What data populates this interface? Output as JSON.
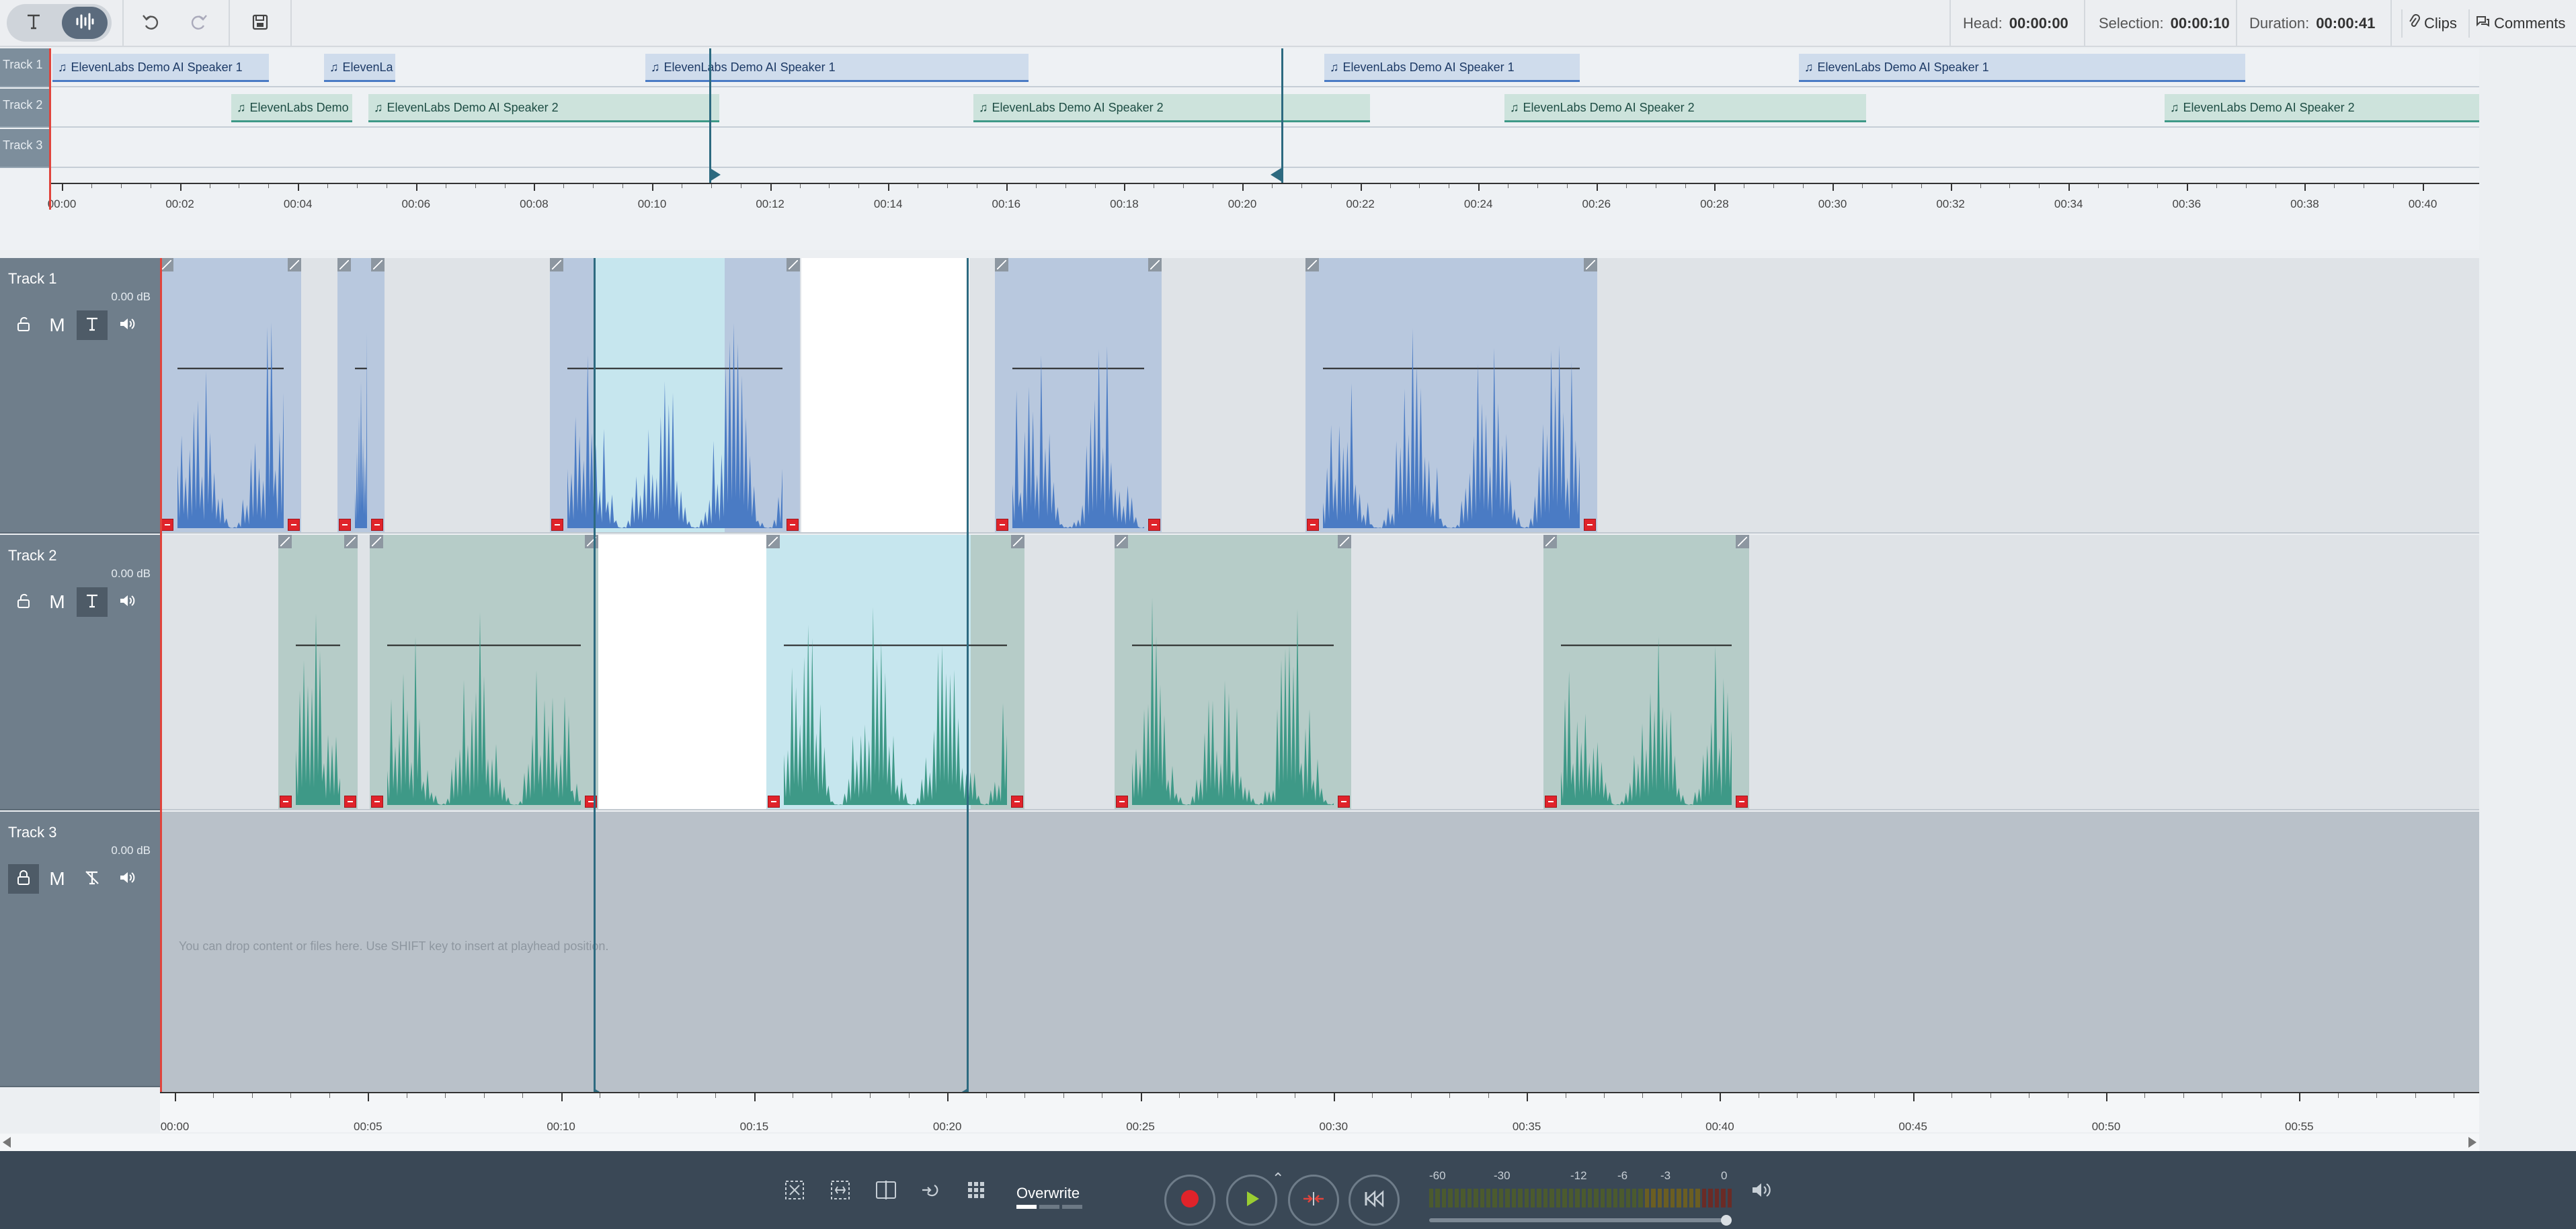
{
  "toolbar": {
    "mode_text_icon": "text-mode-icon",
    "mode_wave_icon": "waveform-mode-icon",
    "head_label": "Head:",
    "head_value": "00:00:00",
    "selection_label": "Selection:",
    "selection_value": "00:00:10",
    "duration_label": "Duration:",
    "duration_value": "00:00:41",
    "clips_label": "Clips",
    "comments_label": "Comments"
  },
  "overview": {
    "track_labels": [
      "Track 1",
      "Track 2",
      "Track 3"
    ],
    "track1_clips": [
      "ElevenLabs Demo AI Speaker 1",
      "ElevenLa",
      "ElevenLabs Demo AI Speaker 1",
      "ElevenLabs Demo AI Speaker 1",
      "ElevenLabs Demo AI Speaker 1"
    ],
    "track2_clips": [
      "ElevenLabs Demo",
      "ElevenLabs Demo AI Speaker 2",
      "ElevenLabs Demo AI Speaker 2",
      "ElevenLabs Demo AI Speaker 2",
      "ElevenLabs Demo AI Speaker 2"
    ],
    "ruler_labels": [
      "00:00",
      "00:02",
      "00:04",
      "00:06",
      "00:08",
      "00:10",
      "00:12",
      "00:14",
      "00:16",
      "00:18",
      "00:20",
      "00:22",
      "00:24",
      "00:26",
      "00:28",
      "00:30",
      "00:32",
      "00:34",
      "00:36",
      "00:38",
      "00:40"
    ]
  },
  "tracks": [
    {
      "name": "Track 1",
      "gain": "0.00 dB",
      "locked": false,
      "mute_label": "M"
    },
    {
      "name": "Track 2",
      "gain": "0.00 dB",
      "locked": false,
      "mute_label": "M"
    },
    {
      "name": "Track 3",
      "gain": "0.00 dB",
      "locked": true,
      "mute_label": "M"
    }
  ],
  "drop_hint": "You can drop content or files here.  Use SHIFT key to insert at playhead position.",
  "bottom_ruler": [
    "00:00",
    "00:05",
    "00:10",
    "00:15",
    "00:20",
    "00:25",
    "00:30",
    "00:35",
    "00:40",
    "00:45",
    "00:50",
    "00:55"
  ],
  "transport": {
    "overwrite_label": "Overwrite",
    "meter_labels": [
      "-60",
      "-30",
      "-12",
      "-6",
      "-3",
      "0"
    ]
  },
  "colors": {
    "speaker1": "#4a7bc4",
    "speaker2": "#3e9987",
    "selection_line": "#2d6a80",
    "playhead": "#e0443c",
    "record": "#e0232a",
    "play": "#9acd32"
  }
}
